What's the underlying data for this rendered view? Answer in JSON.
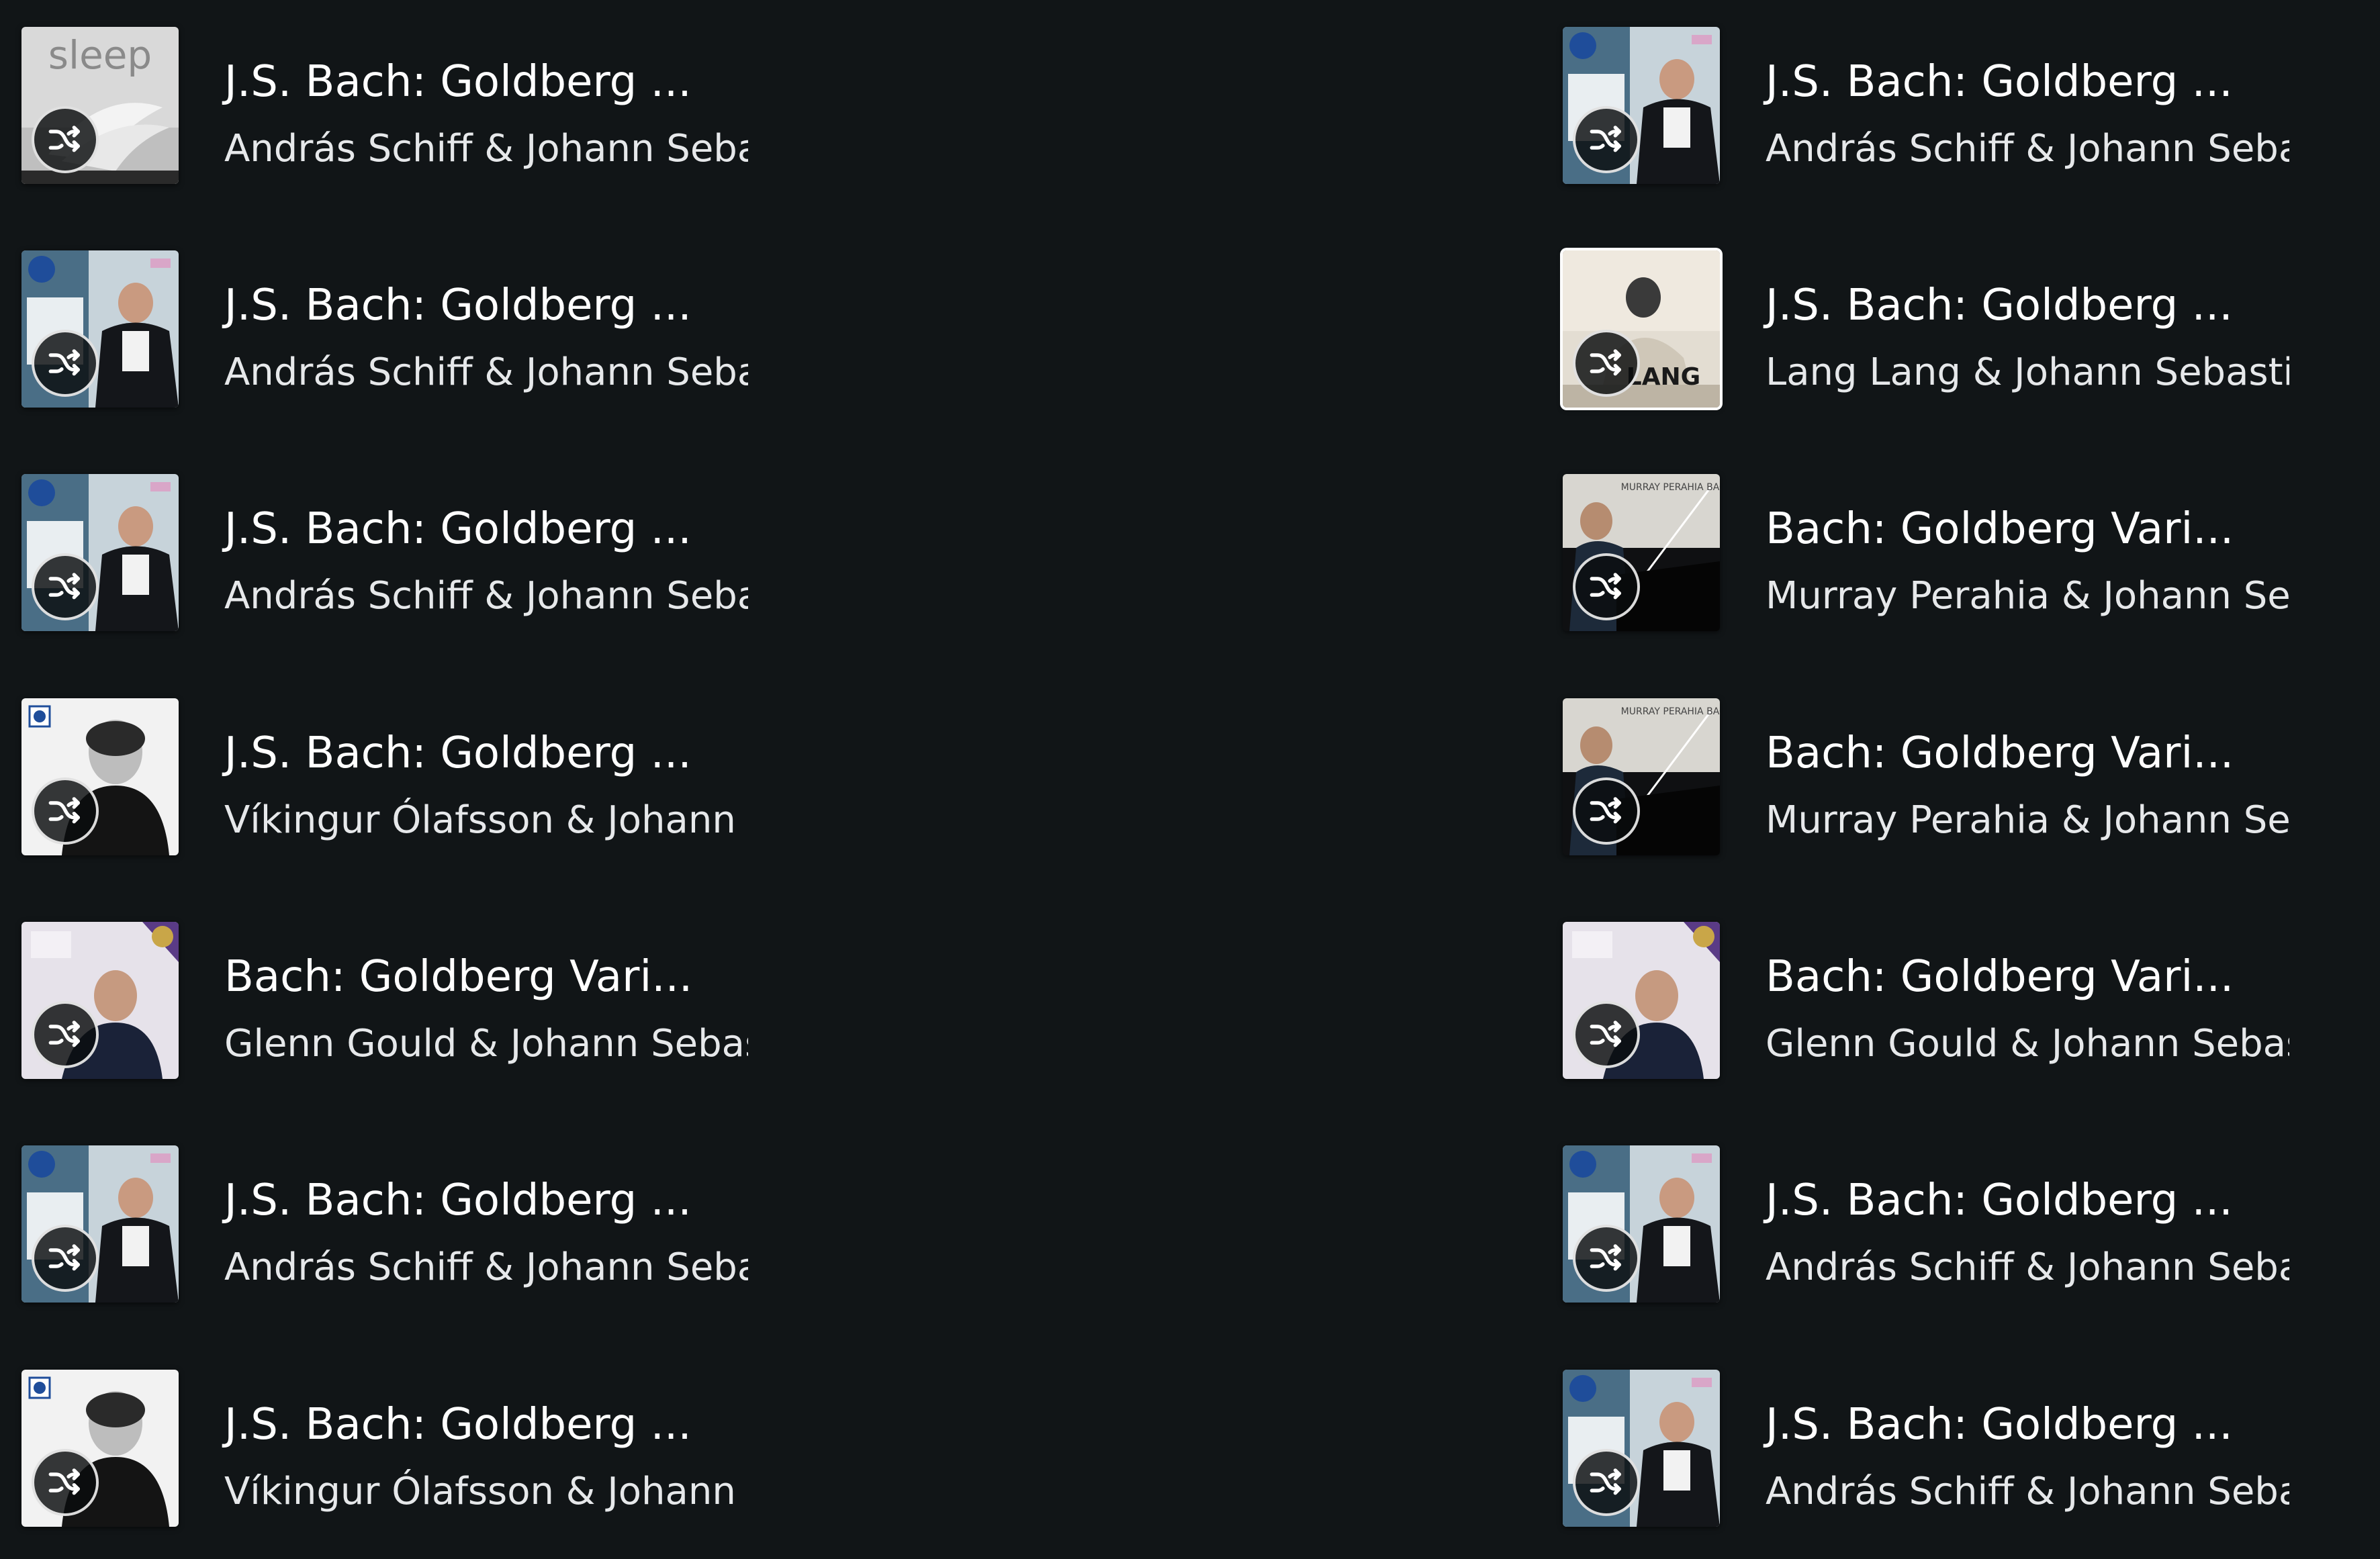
{
  "items": [
    {
      "title": "J.S. Bach: Goldberg ...",
      "artist": "András Schiff & Johann Sebastian Bach",
      "cover": "sleep"
    },
    {
      "title": "J.S. Bach: Goldberg ...",
      "artist": "András Schiff & Johann Sebastian Bach",
      "cover": "schiff"
    },
    {
      "title": "J.S. Bach: Goldberg ...",
      "artist": "András Schiff & Johann Sebastian Bach",
      "cover": "schiff"
    },
    {
      "title": "J.S. Bach: Goldberg ...",
      "artist": "Lang Lang & Johann Sebastian Bach",
      "cover": "lang"
    },
    {
      "title": "J.S. Bach: Goldberg ...",
      "artist": "András Schiff & Johann Sebastian Bach",
      "cover": "schiff"
    },
    {
      "title": "Bach: Goldberg Vari...",
      "artist": "Murray Perahia & Johann Sebastian Bach",
      "cover": "perahia"
    },
    {
      "title": "J.S. Bach: Goldberg ...",
      "artist": "Víkingur Ólafsson & Johann Sebastian Bach",
      "cover": "olafsson"
    },
    {
      "title": "Bach: Goldberg Vari...",
      "artist": "Murray Perahia & Johann Sebastian Bach",
      "cover": "perahia"
    },
    {
      "title": "Bach: Goldberg Vari...",
      "artist": "Glenn Gould & Johann Sebastian Bach",
      "cover": "gould"
    },
    {
      "title": "Bach: Goldberg Vari...",
      "artist": "Glenn Gould & Johann Sebastian Bach",
      "cover": "gould"
    },
    {
      "title": "J.S. Bach: Goldberg ...",
      "artist": "András Schiff & Johann Sebastian Bach",
      "cover": "schiff"
    },
    {
      "title": "J.S. Bach: Goldberg ...",
      "artist": "András Schiff & Johann Sebastian Bach",
      "cover": "schiff"
    },
    {
      "title": "J.S. Bach: Goldberg ...",
      "artist": "Víkingur Ólafsson & Johann Sebastian Bach",
      "cover": "olafsson"
    },
    {
      "title": "J.S. Bach: Goldberg ...",
      "artist": "András Schiff & Johann Sebastian Bach",
      "cover": "schiff"
    }
  ],
  "cover_text": {
    "sleep": "sleep",
    "lang": "LANG",
    "perahia": "MURRAY PERAHIA BACH"
  },
  "icons": {
    "shuffle": "shuffle-icon"
  },
  "colors": {
    "background": "#111517",
    "text_primary": "#ffffff",
    "text_secondary": "#e6e8ea"
  }
}
